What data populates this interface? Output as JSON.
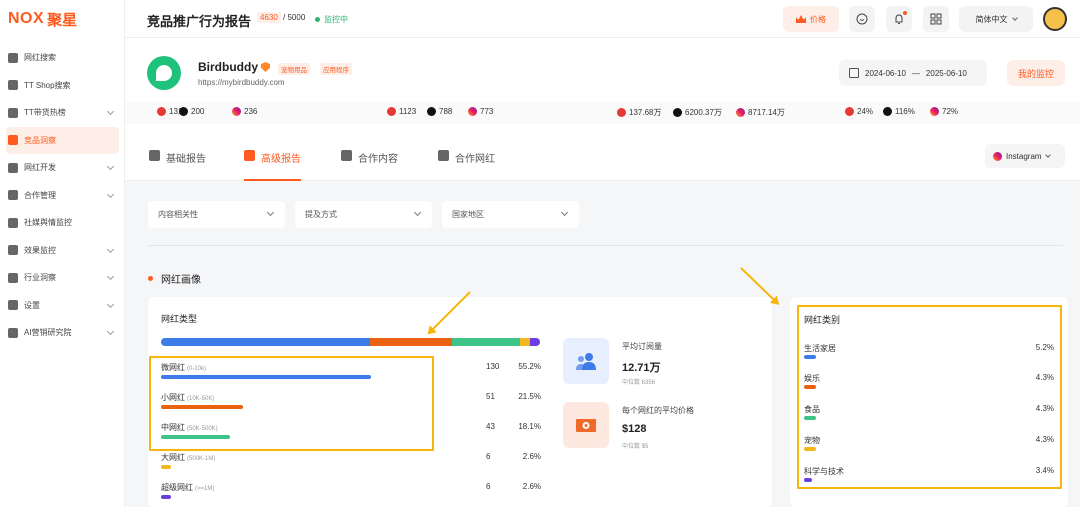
{
  "app": {
    "logo_latin": "NOX",
    "logo_cn": "聚星"
  },
  "sidebar": {
    "items": [
      {
        "label": "网红搜索",
        "icon": "compass-icon",
        "chevron": false,
        "active": false
      },
      {
        "label": "TT Shop搜索",
        "icon": "shop-icon",
        "chevron": false,
        "active": false
      },
      {
        "label": "TT带货热榜",
        "icon": "bar-chart-icon",
        "chevron": true,
        "active": false
      },
      {
        "label": "竞品洞察",
        "icon": "shield-icon",
        "chevron": false,
        "active": true
      },
      {
        "label": "网红开发",
        "icon": "users-icon",
        "chevron": true,
        "active": false
      },
      {
        "label": "合作管理",
        "icon": "document-icon",
        "chevron": true,
        "active": false
      },
      {
        "label": "社媒舆情监控",
        "icon": "line-chart-icon",
        "chevron": false,
        "active": false
      },
      {
        "label": "效果监控",
        "icon": "target-icon",
        "chevron": true,
        "active": false
      },
      {
        "label": "行业洞察",
        "icon": "trend-icon",
        "chevron": true,
        "active": false
      },
      {
        "label": "设置",
        "icon": "gear-icon",
        "chevron": true,
        "active": false
      },
      {
        "label": "AI营销研究院",
        "icon": "ai-icon",
        "chevron": true,
        "active": false
      }
    ]
  },
  "header": {
    "title": "竞品推广行为报告",
    "quota_used": "4630",
    "quota_total": " / 5000",
    "status": "监控中",
    "price_label": "价格",
    "language": "简体中文"
  },
  "brand": {
    "name": "Birdbuddy",
    "tags": [
      "宠物用品",
      "应用程序"
    ],
    "url": "https://mybirdbuddy.com",
    "date_start": "2024-06-10",
    "date_sep": "—",
    "date_end": "2025-06-10",
    "my_monitor": "我的监控"
  },
  "stats": [
    {
      "platform": "youtube",
      "value": "131"
    },
    {
      "platform": "tiktok",
      "value": "200"
    },
    {
      "platform": "instagram",
      "value": "236"
    },
    {
      "platform": "youtube",
      "value": "1123"
    },
    {
      "platform": "tiktok",
      "value": "788"
    },
    {
      "platform": "instagram",
      "value": "773"
    },
    {
      "platform": "youtube",
      "value": "137.68万"
    },
    {
      "platform": "tiktok",
      "value": "6200.37万"
    },
    {
      "platform": "instagram",
      "value": "8717.14万"
    },
    {
      "platform": "youtube",
      "value": "24%"
    },
    {
      "platform": "tiktok",
      "value": "116%"
    },
    {
      "platform": "instagram",
      "value": "72%"
    }
  ],
  "tabs": [
    {
      "label": "基础报告",
      "icon": "grid-icon",
      "active": false
    },
    {
      "label": "高级报告",
      "icon": "report-icon",
      "active": true
    },
    {
      "label": "合作内容",
      "icon": "content-icon",
      "active": false
    },
    {
      "label": "合作网红",
      "icon": "person-icon",
      "active": false
    }
  ],
  "platform_select": "Instagram",
  "filters": [
    "内容相关性",
    "提及方式",
    "国家地区"
  ],
  "section_title": "网红画像",
  "influencer_types": {
    "title": "网红类型",
    "rows": [
      {
        "label": "微网红",
        "range": "(0-10k)",
        "count": "130",
        "pct": "55.2%",
        "value": 55.2,
        "color": "#3d7be8"
      },
      {
        "label": "小网红",
        "range": "(10K-50K)",
        "count": "51",
        "pct": "21.5%",
        "value": 21.5,
        "color": "#e8620f"
      },
      {
        "label": "中网红",
        "range": "(50K-500K)",
        "count": "43",
        "pct": "18.1%",
        "value": 18.1,
        "color": "#3ec486"
      },
      {
        "label": "大网红",
        "range": "(500K-1M)",
        "count": "6",
        "pct": "2.6%",
        "value": 2.6,
        "color": "#f2b720"
      },
      {
        "label": "超级网红",
        "range": "(>=1M)",
        "count": "6",
        "pct": "2.6%",
        "value": 2.6,
        "color": "#6a3ee0"
      }
    ]
  },
  "metrics": [
    {
      "label": "平均订阅量",
      "value": "12.71万",
      "sub": "中位数 6356",
      "icon": "users-icon"
    },
    {
      "label": "每个网红的平均价格",
      "value": "$128",
      "sub": "中位数 $5",
      "icon": "money-icon"
    }
  ],
  "categories": {
    "title": "网红类别",
    "rows": [
      {
        "label": "生活家居",
        "pct": "5.2%",
        "color": "#3d7be8"
      },
      {
        "label": "娱乐",
        "pct": "4.3%",
        "color": "#e8620f"
      },
      {
        "label": "食品",
        "pct": "4.3%",
        "color": "#3ec486"
      },
      {
        "label": "宠物",
        "pct": "4.3%",
        "color": "#f2b720"
      },
      {
        "label": "科学与技术",
        "pct": "3.4%",
        "color": "#6a3ee0"
      }
    ]
  }
}
